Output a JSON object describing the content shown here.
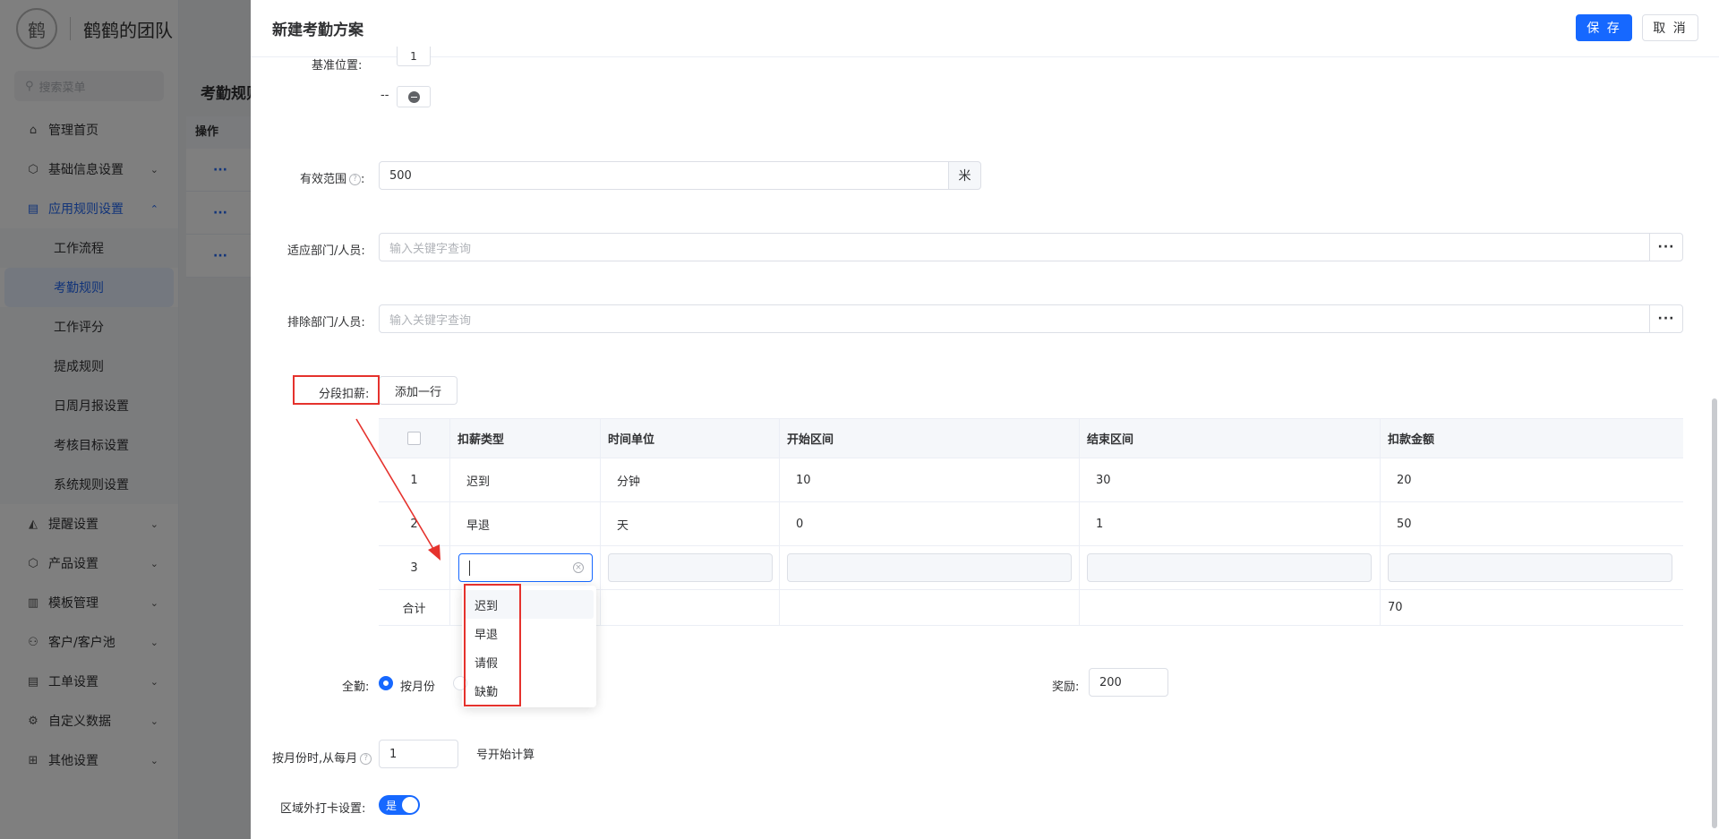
{
  "sidebar": {
    "logo_text": "鹤",
    "team_name": "鹤鹤的团队",
    "search_placeholder": "搜索菜单",
    "items": [
      {
        "label": "管理首页",
        "icon": "⌂",
        "arrow": ""
      },
      {
        "label": "基础信息设置",
        "icon": "⬡",
        "arrow": "⌄"
      },
      {
        "label": "应用规则设置",
        "icon": "▤",
        "arrow": "⌃"
      }
    ],
    "sub_items": [
      "工作流程",
      "考勤规则",
      "工作评分",
      "提成规则",
      "日周月报设置",
      "考核目标设置",
      "系统规则设置"
    ],
    "active_sub": "考勤规则",
    "items_after": [
      {
        "label": "提醒设置",
        "icon": "◭",
        "arrow": "⌄"
      },
      {
        "label": "产品设置",
        "icon": "⬡",
        "arrow": "⌄"
      },
      {
        "label": "模板管理",
        "icon": "▥",
        "arrow": "⌄"
      },
      {
        "label": "客户/客户池",
        "icon": "⚇",
        "arrow": "⌄"
      },
      {
        "label": "工单设置",
        "icon": "▤",
        "arrow": "⌄"
      },
      {
        "label": "自定义数据",
        "icon": "⚙",
        "arrow": "⌄"
      },
      {
        "label": "其他设置",
        "icon": "⊞",
        "arrow": "⌄"
      }
    ]
  },
  "main": {
    "title": "考勤规则",
    "table_header": "操作",
    "row_action": "···"
  },
  "drawer": {
    "title": "新建考勤方案",
    "save_label": "保 存",
    "cancel_label": "取 消",
    "base_position_label": "基准位置:",
    "base_position_value": "1",
    "dash": "--",
    "range_label": "有效范围",
    "range_value": "500",
    "range_unit": "米",
    "dept_label": "适应部门/人员:",
    "dept_placeholder": "输入关键字查询",
    "exclude_label": "排除部门/人员:",
    "exclude_placeholder": "输入关键字查询",
    "dots": "···",
    "segment_label": "分段扣薪:",
    "add_row_label": "添加一行",
    "table": {
      "headers": [
        "扣薪类型",
        "时间单位",
        "开始区间",
        "结束区间",
        "扣款金额"
      ],
      "rows": [
        {
          "no": "1",
          "type": "迟到",
          "unit": "分钟",
          "start": "10",
          "end": "30",
          "amount": "20"
        },
        {
          "no": "2",
          "type": "早退",
          "unit": "天",
          "start": "0",
          "end": "1",
          "amount": "50"
        }
      ],
      "editing_row_no": "3",
      "sum_label": "合计",
      "sum_amount": "70"
    },
    "dropdown_options": [
      "迟到",
      "早退",
      "请假",
      "缺勤"
    ],
    "full_attendance_label": "全勤:",
    "full_attendance_option": "按月份",
    "reward_label": "奖励:",
    "reward_value": "200",
    "month_start_label": "按月份时,从每月",
    "month_start_value": "1",
    "month_start_suffix": "号开始计算",
    "outside_label": "区域外打卡设置:",
    "outside_toggle": "是"
  },
  "colors": {
    "primary": "#1668ff",
    "annotation": "#e5322d",
    "mask": "rgba(0,0,0,0.5)"
  }
}
